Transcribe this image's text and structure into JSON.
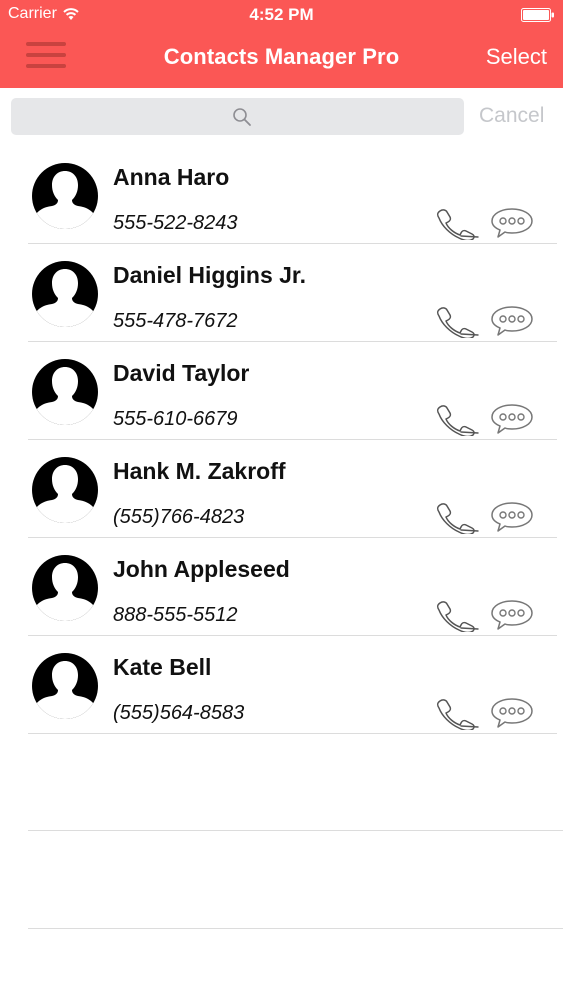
{
  "status_bar": {
    "carrier": "Carrier",
    "time": "4:52 PM"
  },
  "nav": {
    "title": "Contacts Manager Pro",
    "select_label": "Select",
    "menu_icon": "hamburger-icon"
  },
  "search": {
    "placeholder": "",
    "value": "",
    "cancel_label": "Cancel",
    "icon": "search-icon"
  },
  "contacts": [
    {
      "name": "Anna Haro",
      "phone": "555-522-8243"
    },
    {
      "name": "Daniel Higgins Jr.",
      "phone": "555-478-7672"
    },
    {
      "name": "David Taylor",
      "phone": "555-610-6679"
    },
    {
      "name": "Hank M. Zakroff",
      "phone": "(555)766-4823"
    },
    {
      "name": "John Appleseed",
      "phone": "888-555-5512"
    },
    {
      "name": "Kate Bell",
      "phone": "(555)564-8583"
    }
  ],
  "row_icons": {
    "call": "phone-icon",
    "message": "message-icon",
    "avatar": "avatar-silhouette-icon"
  },
  "colors": {
    "header": "#fb5755",
    "header_text": "#ffffff",
    "search_field": "#e6e7e9",
    "cancel_text": "#c5c7cb",
    "divider": "#dcdcdc"
  }
}
